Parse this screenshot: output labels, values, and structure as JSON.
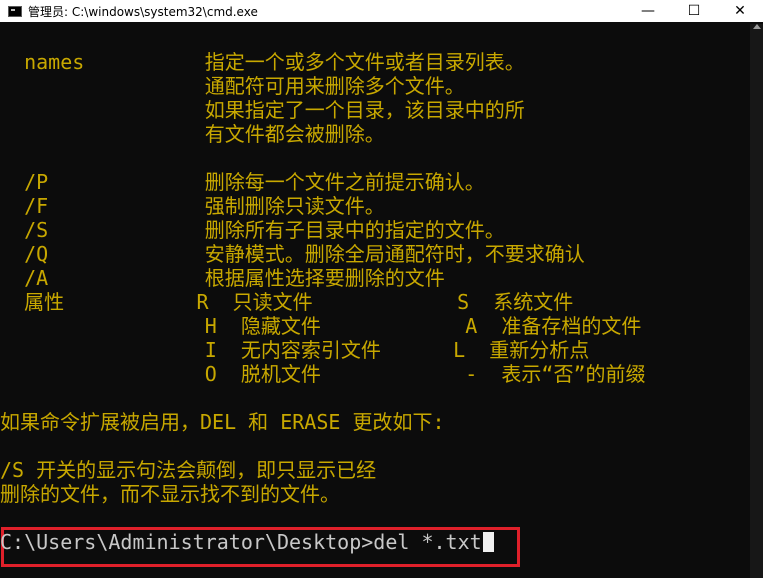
{
  "window": {
    "title": "管理员: C:\\windows\\system32\\cmd.exe",
    "minimize": "—",
    "maximize": "☐",
    "close": "✕"
  },
  "console": {
    "lines": [
      "  names          指定一个或多个文件或者目录列表。",
      "                 通配符可用来删除多个文件。",
      "                 如果指定了一个目录，该目录中的所",
      "                 有文件都会被删除。",
      "",
      "  /P             删除每一个文件之前提示确认。",
      "  /F             强制删除只读文件。",
      "  /S             删除所有子目录中的指定的文件。",
      "  /Q             安静模式。删除全局通配符时，不要求确认",
      "  /A             根据属性选择要删除的文件",
      "  属性           R  只读文件            S  系统文件",
      "                 H  隐藏文件            A  准备存档的文件",
      "                 I  无内容索引文件      L  重新分析点",
      "                 O  脱机文件            -  表示“否”的前缀",
      "",
      "如果命令扩展被启用，DEL 和 ERASE 更改如下:",
      "",
      "/S 开关的显示句法会颠倒，即只显示已经",
      "删除的文件，而不显示找不到的文件。"
    ],
    "prompt": "C:\\Users\\Administrator\\Desktop>",
    "command": "del *.txt"
  }
}
